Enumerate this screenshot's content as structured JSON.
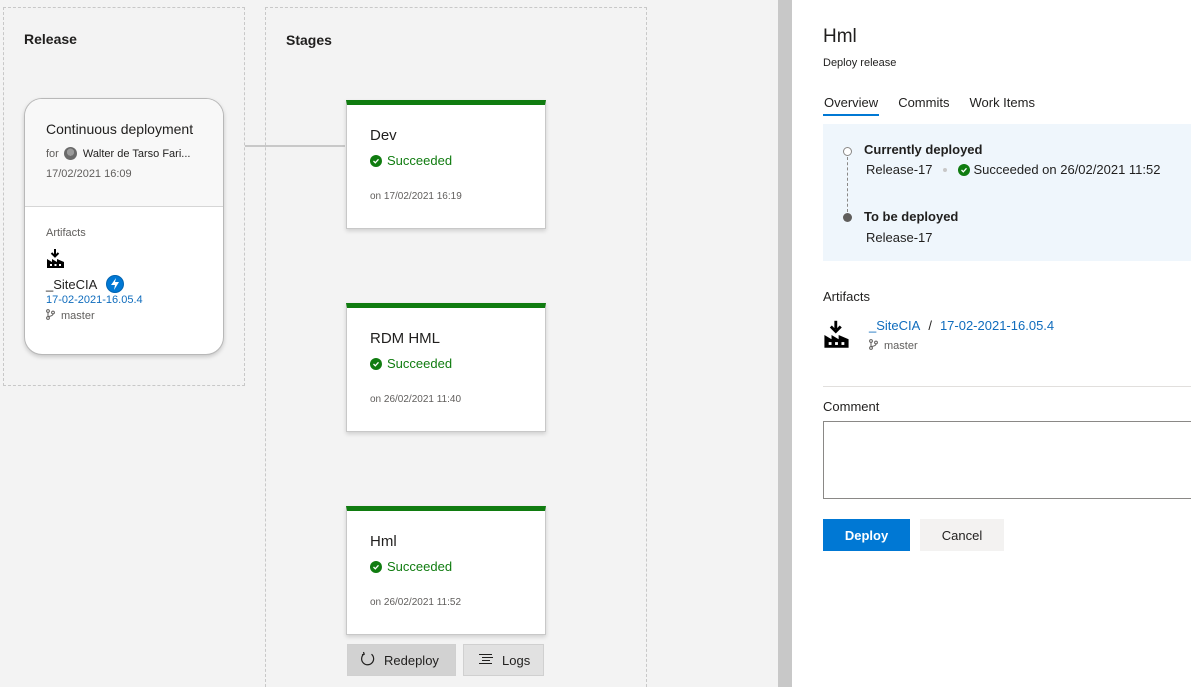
{
  "release_section": {
    "title": "Release",
    "card": {
      "trigger": "Continuous deployment",
      "for_label": "for",
      "author": "Walter de Tarso Fari...",
      "date": "17/02/2021 16:09",
      "artifacts_label": "Artifacts",
      "artifact_name": "_SiteCIA",
      "artifact_version": "17-02-2021-16.05.4",
      "branch": "master"
    }
  },
  "stages_section": {
    "title": "Stages",
    "stages": [
      {
        "name": "Dev",
        "status": "Succeeded",
        "date": "on 17/02/2021 16:19"
      },
      {
        "name": "RDM HML",
        "status": "Succeeded",
        "date": "on 26/02/2021 11:40"
      },
      {
        "name": "Hml",
        "status": "Succeeded",
        "date": "on 26/02/2021 11:52"
      }
    ],
    "actions": {
      "redeploy": "Redeploy",
      "logs": "Logs"
    }
  },
  "panel": {
    "title": "Hml",
    "subtitle": "Deploy release",
    "tabs": [
      "Overview",
      "Commits",
      "Work Items"
    ],
    "active_tab": "Overview",
    "currently_deployed": {
      "label": "Currently deployed",
      "release": "Release-17",
      "status": "Succeeded on 26/02/2021 11:52"
    },
    "to_be_deployed": {
      "label": "To be deployed",
      "release": "Release-17"
    },
    "artifacts": {
      "label": "Artifacts",
      "name": "_SiteCIA",
      "separator": "/",
      "version": "17-02-2021-16.05.4",
      "branch": "master"
    },
    "comment": {
      "label": "Comment",
      "value": ""
    },
    "buttons": {
      "deploy": "Deploy",
      "cancel": "Cancel"
    }
  },
  "colors": {
    "accent": "#0078d4",
    "success": "#107c10",
    "link": "#0f6cbd"
  }
}
